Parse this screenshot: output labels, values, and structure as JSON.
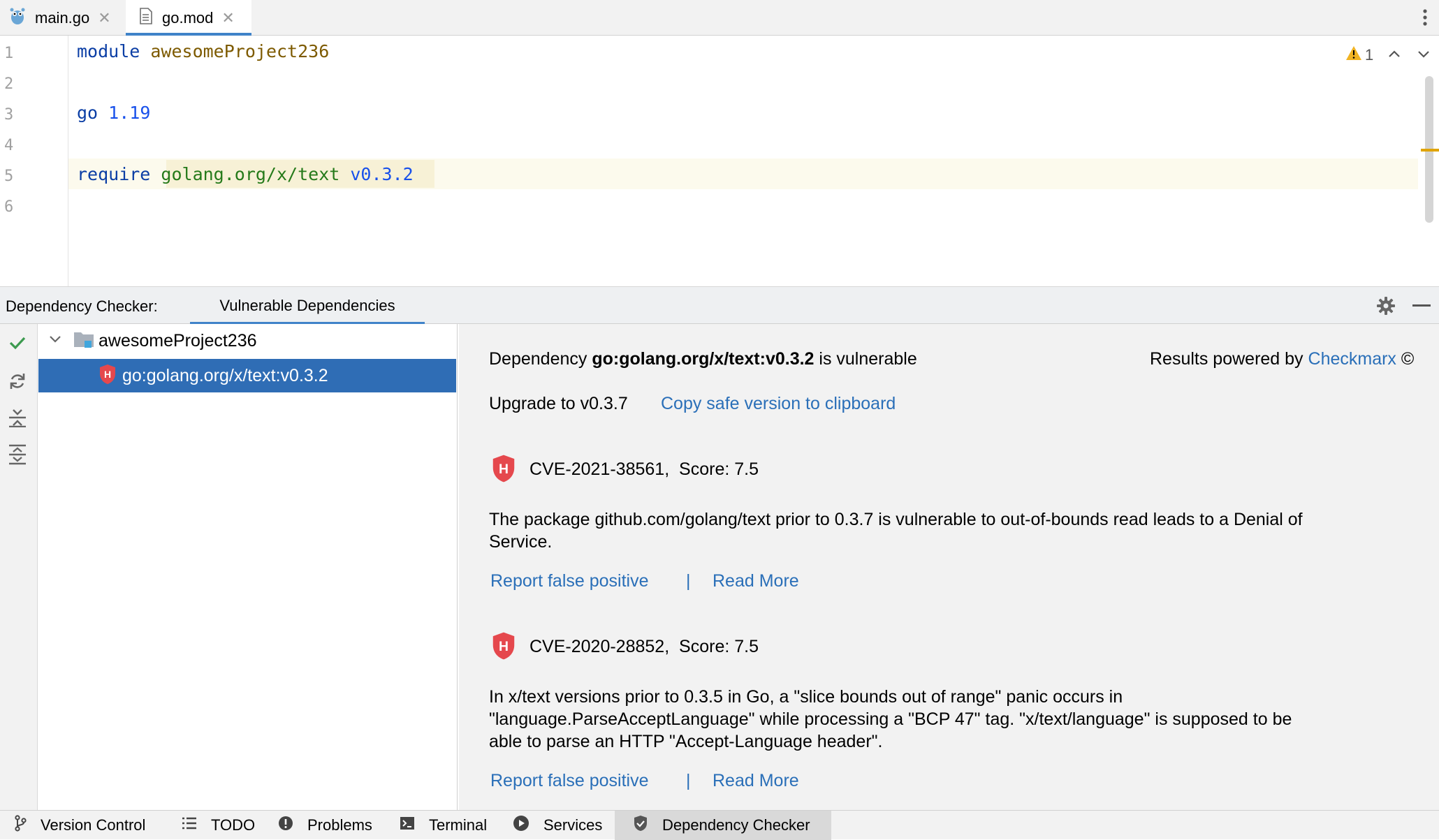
{
  "tabs": [
    {
      "label": "main.go",
      "icon": "gopher-icon"
    },
    {
      "label": "go.mod",
      "icon": "file-icon",
      "active": true
    }
  ],
  "editor": {
    "line_numbers": [
      "1",
      "2",
      "3",
      "4",
      "5",
      "6"
    ],
    "line1": {
      "keyword": "module",
      "name": "awesomeProject236"
    },
    "line3": {
      "keyword": "go",
      "version": "1.19"
    },
    "line5": {
      "keyword": "require",
      "path": "golang.org/x/text",
      "version": "v0.3.2"
    },
    "warning_count": "1"
  },
  "toolwindow": {
    "title": "Dependency Checker:",
    "tab": "Vulnerable Dependencies"
  },
  "tree": {
    "root": "awesomeProject236",
    "child": "go:golang.org/x/text:v0.3.2"
  },
  "details": {
    "dep_prefix": "Dependency",
    "dep_name": "go:golang.org/x/text:v0.3.2",
    "dep_suffix": "is vulnerable",
    "powered_by": "Results powered by",
    "powered_link": "Checkmarx",
    "powered_symbol": "©",
    "upgrade_text": "Upgrade to v0.3.7",
    "copy_link": "Copy safe version to clipboard",
    "cves": [
      {
        "id": "CVE-2021-38561,",
        "score": "Score: 7.5",
        "desc_lines": [
          "The package github.com/golang/text prior to 0.3.7 is vulnerable to out-of-bounds read leads to a Denial of",
          "Service."
        ],
        "report": "Report false positive",
        "sep": "|",
        "read": "Read More"
      },
      {
        "id": "CVE-2020-28852,",
        "score": "Score: 7.5",
        "desc_lines": [
          "In x/text versions prior to 0.3.5 in Go, a \"slice bounds out of range\" panic occurs in",
          "\"language.ParseAcceptLanguage\" while processing a \"BCP 47\" tag. \"x/text/language\" is supposed to be",
          "able to parse an HTTP \"Accept-Language header\"."
        ],
        "report": "Report false positive",
        "sep": "|",
        "read": "Read More"
      }
    ]
  },
  "bottom_tabs": [
    {
      "label": "Version Control",
      "icon": "branch-icon"
    },
    {
      "label": "TODO",
      "icon": "list-icon"
    },
    {
      "label": "Problems",
      "icon": "problems-icon"
    },
    {
      "label": "Terminal",
      "icon": "terminal-icon"
    },
    {
      "label": "Services",
      "icon": "services-icon"
    },
    {
      "label": "Dependency Checker",
      "icon": "shield-check-icon",
      "active": true
    }
  ],
  "colors": {
    "selection": "#2f6db5",
    "link": "#2a6fb8",
    "shield": "#e5484d",
    "tab_underline": "#4083c9"
  }
}
